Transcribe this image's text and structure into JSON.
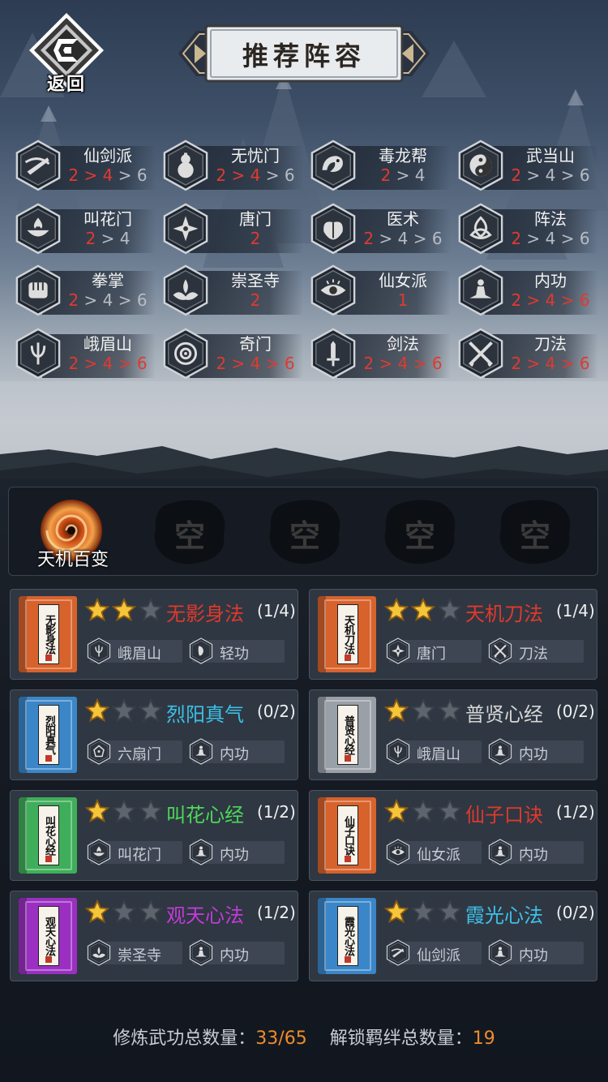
{
  "header": {
    "back_label": "返回",
    "title": "推荐阵容"
  },
  "sects": [
    {
      "name": "仙剑派",
      "levels": [
        {
          "t": "2",
          "on": true
        },
        {
          "t": " > ",
          "on": true
        },
        {
          "t": "4",
          "on": true
        },
        {
          "t": " > 6",
          "on": false
        }
      ],
      "icon": "flying-sword-icon"
    },
    {
      "name": "无忧门",
      "levels": [
        {
          "t": "2",
          "on": true
        },
        {
          "t": " > ",
          "on": true
        },
        {
          "t": "4",
          "on": true
        },
        {
          "t": " > 6",
          "on": false
        }
      ],
      "icon": "gourd-icon"
    },
    {
      "name": "毒龙帮",
      "levels": [
        {
          "t": "2",
          "on": true
        },
        {
          "t": " > 4",
          "on": false
        }
      ],
      "icon": "dragon-icon"
    },
    {
      "name": "武当山",
      "levels": [
        {
          "t": "2",
          "on": true
        },
        {
          "t": " > 4 > 6",
          "on": false
        }
      ],
      "icon": "yin-yang-icon"
    },
    {
      "name": "叫花门",
      "levels": [
        {
          "t": "2",
          "on": true
        },
        {
          "t": " > 4",
          "on": false
        }
      ],
      "icon": "bowl-flame-icon"
    },
    {
      "name": "唐门",
      "levels": [
        {
          "t": "2",
          "on": true
        }
      ],
      "icon": "shuriken-icon"
    },
    {
      "name": "医术",
      "levels": [
        {
          "t": "2",
          "on": true
        },
        {
          "t": " > 4 > 6",
          "on": false
        }
      ],
      "icon": "herb-icon"
    },
    {
      "name": "阵法",
      "levels": [
        {
          "t": "2",
          "on": true
        },
        {
          "t": " > 4 > 6",
          "on": false
        }
      ],
      "icon": "triquetra-icon"
    },
    {
      "name": "拳掌",
      "levels": [
        {
          "t": "2",
          "on": true
        },
        {
          "t": " > 4 > 6",
          "on": false
        }
      ],
      "icon": "fist-icon"
    },
    {
      "name": "崇圣寺",
      "levels": [
        {
          "t": "2",
          "on": true
        }
      ],
      "icon": "lotus-flame-icon"
    },
    {
      "name": "仙女派",
      "levels": [
        {
          "t": "1",
          "on": true
        }
      ],
      "icon": "eye-icon"
    },
    {
      "name": "内功",
      "levels": [
        {
          "t": "2 > 4 > 6",
          "on": true
        }
      ],
      "icon": "meditation-icon"
    },
    {
      "name": "峨眉山",
      "levels": [
        {
          "t": "2 > 4 > 6",
          "on": true
        }
      ],
      "icon": "trident-icon"
    },
    {
      "name": "奇门",
      "levels": [
        {
          "t": "2 > 4 > 6",
          "on": true
        }
      ],
      "icon": "mandala-icon"
    },
    {
      "name": "剑法",
      "levels": [
        {
          "t": "2 > 4 > 6",
          "on": true
        }
      ],
      "icon": "sword-icon"
    },
    {
      "name": "刀法",
      "levels": [
        {
          "t": "2 > 4 > 6",
          "on": true
        }
      ],
      "icon": "crossed-blades-icon"
    }
  ],
  "slots": {
    "active_name": "天机百变",
    "empty_label": "空"
  },
  "cards": [
    {
      "book_label": "无影身法",
      "title": "无影身法",
      "title_color": "#e0392c",
      "count": "(1/4)",
      "stars": 2,
      "book_color": "#d8622c",
      "tags": [
        {
          "text": "峨眉山",
          "icon": "trident-icon"
        },
        {
          "text": "轻功",
          "icon": "footstep-icon"
        }
      ]
    },
    {
      "book_label": "天机刀法",
      "title": "天机刀法",
      "title_color": "#e0392c",
      "count": "(1/4)",
      "stars": 2,
      "book_color": "#d8622c",
      "tags": [
        {
          "text": "唐门",
          "icon": "shuriken-icon"
        },
        {
          "text": "刀法",
          "icon": "crossed-blades-icon"
        }
      ]
    },
    {
      "book_label": "烈阳真气",
      "title": "烈阳真气",
      "title_color": "#3ec0e8",
      "count": "(0/2)",
      "stars": 1,
      "book_color": "#3a86c8",
      "tags": [
        {
          "text": "六扇门",
          "icon": "badge-icon"
        },
        {
          "text": "内功",
          "icon": "meditation-icon"
        }
      ]
    },
    {
      "book_label": "普贤心经",
      "title": "普贤心经",
      "title_color": "#d6d6d6",
      "count": "(0/2)",
      "stars": 1,
      "book_color": "#9aa0a8",
      "tags": [
        {
          "text": "峨眉山",
          "icon": "trident-icon"
        },
        {
          "text": "内功",
          "icon": "meditation-icon"
        }
      ]
    },
    {
      "book_label": "叫花心经",
      "title": "叫花心经",
      "title_color": "#4cd95a",
      "count": "(1/2)",
      "stars": 1,
      "book_color": "#3fae5a",
      "tags": [
        {
          "text": "叫花门",
          "icon": "bowl-flame-icon"
        },
        {
          "text": "内功",
          "icon": "meditation-icon"
        }
      ]
    },
    {
      "book_label": "仙子口诀",
      "title": "仙子口诀",
      "title_color": "#e0392c",
      "count": "(1/2)",
      "stars": 1,
      "book_color": "#d8622c",
      "tags": [
        {
          "text": "仙女派",
          "icon": "eye-icon"
        },
        {
          "text": "内功",
          "icon": "meditation-icon"
        }
      ]
    },
    {
      "book_label": "观天心法",
      "title": "观天心法",
      "title_color": "#c23ad8",
      "count": "(1/2)",
      "stars": 1,
      "book_color": "#9b2fc2",
      "tags": [
        {
          "text": "崇圣寺",
          "icon": "lotus-flame-icon"
        },
        {
          "text": "内功",
          "icon": "meditation-icon"
        }
      ]
    },
    {
      "book_label": "霞光心法",
      "title": "霞光心法",
      "title_color": "#3ec0e8",
      "count": "(0/2)",
      "stars": 1,
      "book_color": "#3a86c8",
      "tags": [
        {
          "text": "仙剑派",
          "icon": "flying-sword-icon"
        },
        {
          "text": "内功",
          "icon": "meditation-icon"
        }
      ]
    }
  ],
  "footer": {
    "arts_label": "修炼武功总数量：",
    "arts_value": "33/65",
    "bonds_label": "解锁羁绊总数量：",
    "bonds_value": "19"
  }
}
